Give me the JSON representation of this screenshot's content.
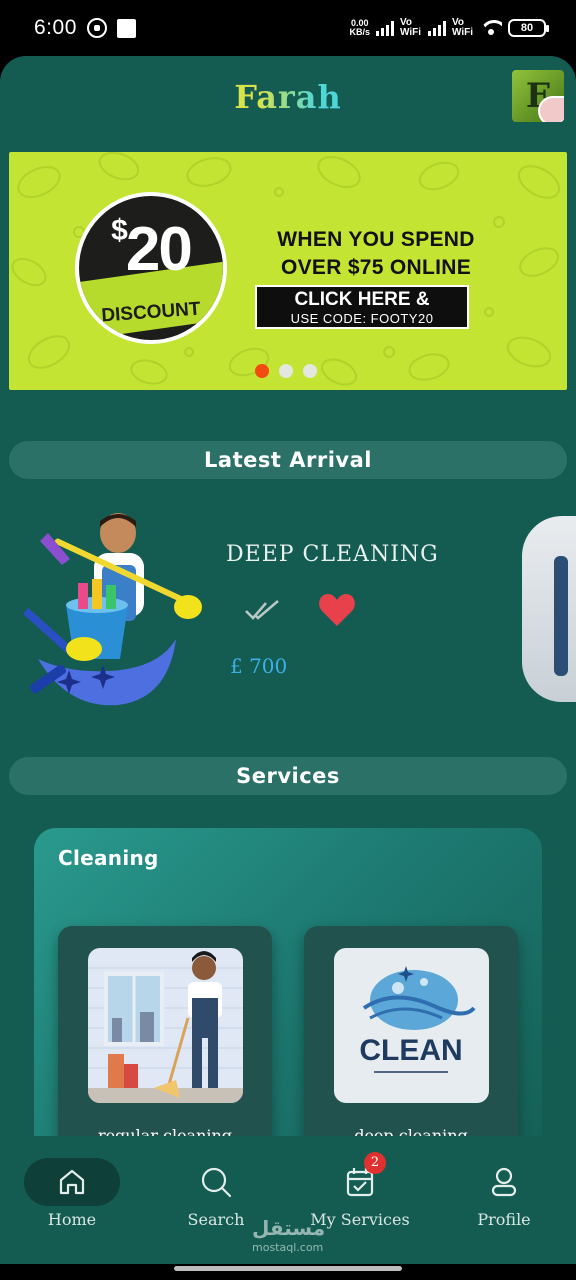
{
  "status_bar": {
    "time": "6:00",
    "speed_value": "0.00",
    "speed_unit": "KB/s",
    "network_1": "Vo WiFi",
    "network_2": "Vo WiFi",
    "battery": "80"
  },
  "header": {
    "app_title": "Farah",
    "logo_icon": "farah-logo-icon"
  },
  "banner": {
    "discount_amount": "20",
    "discount_currency": "$",
    "discount_label": "DISCOUNT",
    "promo_line_1": "WHEN YOU SPEND",
    "promo_line_2": "OVER $75 ONLINE",
    "cta_line_1": "CLICK HERE &",
    "cta_line_2": "USE CODE: FOOTY20",
    "carousel": {
      "count": 3,
      "active_index": 0
    },
    "colors": {
      "background": "#c3e432",
      "active_dot": "#f34a12"
    }
  },
  "latest_arrival": {
    "heading": "Latest Arrival",
    "item": {
      "title": "DEEP CLEANING",
      "price": "£ 700",
      "favorite": true
    }
  },
  "services": {
    "heading": "Services",
    "category": "Cleaning",
    "items": [
      {
        "label": "regular cleaning",
        "image_text": ""
      },
      {
        "label": "deep cleaning",
        "image_text": "CLEAN"
      }
    ]
  },
  "bottom_nav": {
    "items": [
      {
        "label": "Home",
        "icon": "home-icon",
        "active": true
      },
      {
        "label": "Search",
        "icon": "search-icon",
        "active": false
      },
      {
        "label": "My Services",
        "icon": "calendar-check-icon",
        "active": false,
        "badge": "2"
      },
      {
        "label": "Profile",
        "icon": "profile-icon",
        "active": false
      }
    ]
  },
  "watermark": {
    "arabic": "مستقل",
    "latin": "mostaql.com"
  },
  "theme": {
    "background": "#145c52",
    "accent_price": "#3cb0e4",
    "heart": "#e8414c"
  }
}
